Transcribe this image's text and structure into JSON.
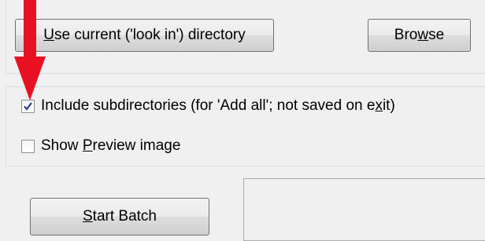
{
  "directory": {
    "use_current_button": {
      "pre": "",
      "accel": "U",
      "post": "se current ('look in') directory"
    },
    "browse_button": {
      "pre": "Bro",
      "accel": "w",
      "post": "se"
    }
  },
  "options": {
    "include_subdirectories": {
      "checked": true,
      "label_pre": "Include subdirectories (for 'Add all'; not saved on e",
      "label_accel": "x",
      "label_post": "it)"
    },
    "show_preview": {
      "checked": false,
      "label_pre": "Show ",
      "label_accel": "P",
      "label_post": "review image"
    }
  },
  "batch": {
    "start_button": {
      "pre": "",
      "accel": "S",
      "post": "tart Batch"
    }
  },
  "colors": {
    "annotation_arrow": "#e81123",
    "check_mark": "#2a3f8c"
  }
}
